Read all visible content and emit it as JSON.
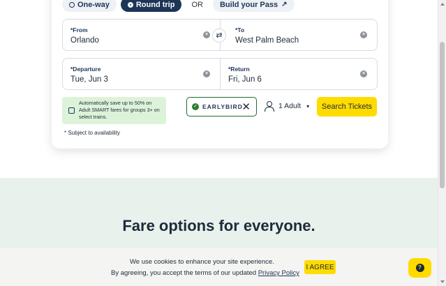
{
  "trip_type": {
    "one_way": "One-way",
    "round_trip": "Round trip",
    "or": "OR",
    "build_pass": "Build your Pass"
  },
  "form": {
    "from_label": "*From",
    "from_value": "Orlando",
    "to_label": "*To",
    "to_value": "West Palm Beach",
    "departure_label": "*Departure",
    "departure_value": "Tue, Jun 3",
    "return_label": "*Return",
    "return_value": "Fri, Jun 6"
  },
  "promo": {
    "text": "Automatically save up to 50% on Adult SMART fares for groups 3+ on select trains."
  },
  "note": "* Subject to availability",
  "promo_code": "EARLYBIRD",
  "passengers": "1 Adult",
  "search_label": "Search Tickets",
  "section_title": "Fare options for everyone.",
  "cookie": {
    "line1": "We use cookies to enhance your site experience.",
    "line2_prefix": "By agreeing, you accept the terms of our updated",
    "link": "Privacy Policy",
    "agree": "I AGREE"
  },
  "help": "?",
  "colors": {
    "accent_yellow": "#ffdb00",
    "navy": "#1d3557",
    "promo_green": "#ddf3d9",
    "band": "#e8f1ec"
  }
}
